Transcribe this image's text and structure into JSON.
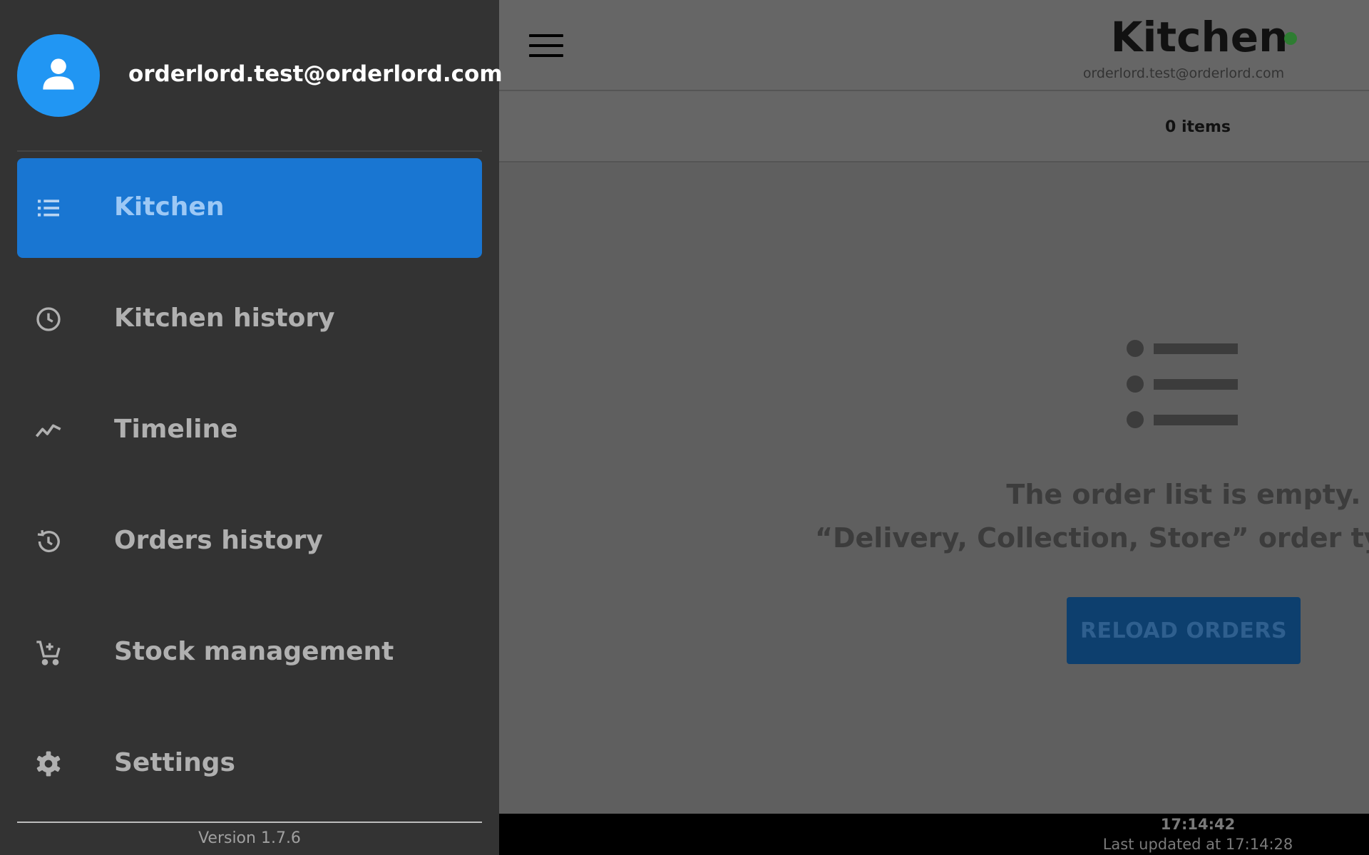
{
  "drawer": {
    "user_email": "orderlord.test@orderlord.com",
    "items": [
      {
        "label": "Kitchen",
        "icon": "list-icon",
        "active": true
      },
      {
        "label": "Kitchen history",
        "icon": "clock-icon",
        "active": false
      },
      {
        "label": "Timeline",
        "icon": "timeline-icon",
        "active": false
      },
      {
        "label": "Orders history",
        "icon": "history-icon",
        "active": false
      },
      {
        "label": "Stock management",
        "icon": "cart-add-icon",
        "active": false
      },
      {
        "label": "Settings",
        "icon": "gear-icon",
        "active": false
      }
    ],
    "version": "Version 1.7.6"
  },
  "appbar": {
    "title": "Kitchen",
    "subtitle": "orderlord.test@orderlord.com",
    "status_color": "#2e7d32"
  },
  "items_bar": {
    "count": "0 items"
  },
  "empty_state": {
    "title": "The order list is empty.",
    "subtitle": "“Delivery, Collection, Store” order types are displayed",
    "button_label": "RELOAD ORDERS"
  },
  "footer": {
    "time": "17:14:42",
    "last_updated": "Last updated at 17:14:28"
  },
  "colors": {
    "drawer_bg": "#333333",
    "accent": "#1976d2",
    "avatar": "#2196f3"
  }
}
